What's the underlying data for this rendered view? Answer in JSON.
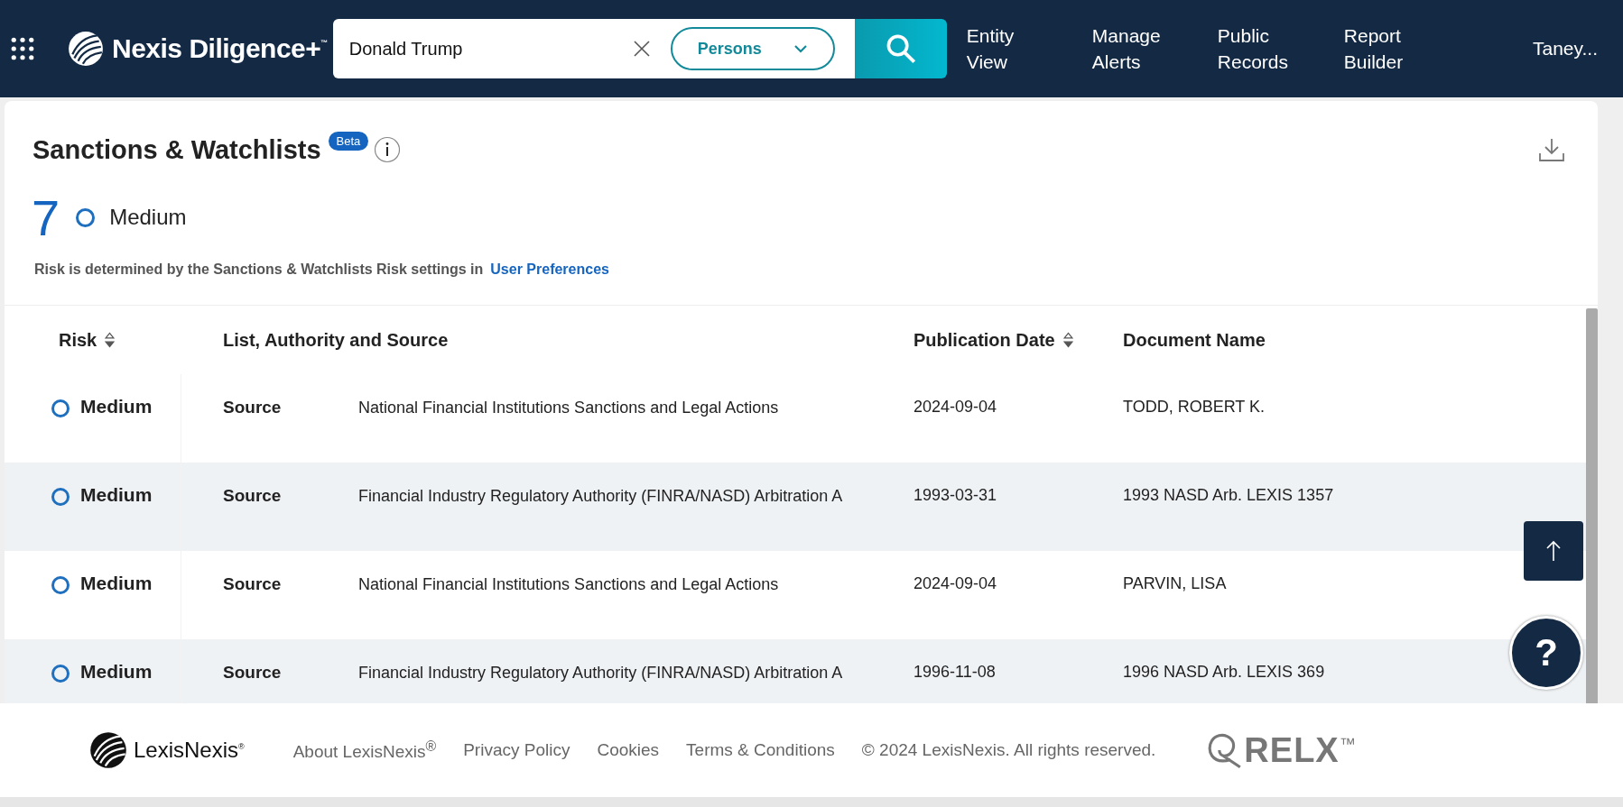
{
  "header": {
    "logo": "Nexis Diligence+",
    "logo_mark": "™",
    "search": {
      "value": "Donald Trump",
      "category": "Persons"
    },
    "nav": [
      {
        "label": "Entity View"
      },
      {
        "label": "Manage Alerts"
      },
      {
        "label": "Public Records"
      },
      {
        "label": "Report Builder"
      }
    ],
    "user": "Taney..."
  },
  "card": {
    "title": "Sanctions & Watchlists",
    "badge": "Beta",
    "summary": {
      "count": "7",
      "risk": "Medium"
    },
    "note": {
      "text": "Risk is determined by the Sanctions & Watchlists Risk settings in",
      "link": "User Preferences"
    }
  },
  "table": {
    "columns": [
      {
        "label": "Risk",
        "sortable": true
      },
      {
        "label": "List, Authority and Source",
        "sortable": false
      },
      {
        "label": "Publication Date",
        "sortable": true
      },
      {
        "label": "Document Name",
        "sortable": false
      }
    ],
    "rows": [
      {
        "risk": "Medium",
        "source_label": "Source",
        "source": "National Financial Institutions Sanctions and Legal Actions",
        "date": "2024-09-04",
        "document": "TODD, ROBERT K."
      },
      {
        "risk": "Medium",
        "source_label": "Source",
        "source": "Financial Industry Regulatory Authority (FINRA/NASD) Arbitration A",
        "date": "1993-03-31",
        "document": "1993 NASD Arb. LEXIS 1357"
      },
      {
        "risk": "Medium",
        "source_label": "Source",
        "source": "National Financial Institutions Sanctions and Legal Actions",
        "date": "2024-09-04",
        "document": "PARVIN, LISA"
      },
      {
        "risk": "Medium",
        "source_label": "Source",
        "source": "Financial Industry Regulatory Authority (FINRA/NASD) Arbitration A",
        "date": "1996-11-08",
        "document": "1996 NASD Arb. LEXIS 369"
      }
    ]
  },
  "help_button": "?",
  "footer": {
    "brand": "LexisNexis",
    "brand_mark": "®",
    "links": [
      "About LexisNexis$^{®}$",
      "Privacy Policy",
      "Cookies",
      "Terms & Conditions"
    ],
    "copyright": "© 2024 LexisNexis. All rights reserved.",
    "relx": "RELX",
    "relx_mark": "™"
  }
}
